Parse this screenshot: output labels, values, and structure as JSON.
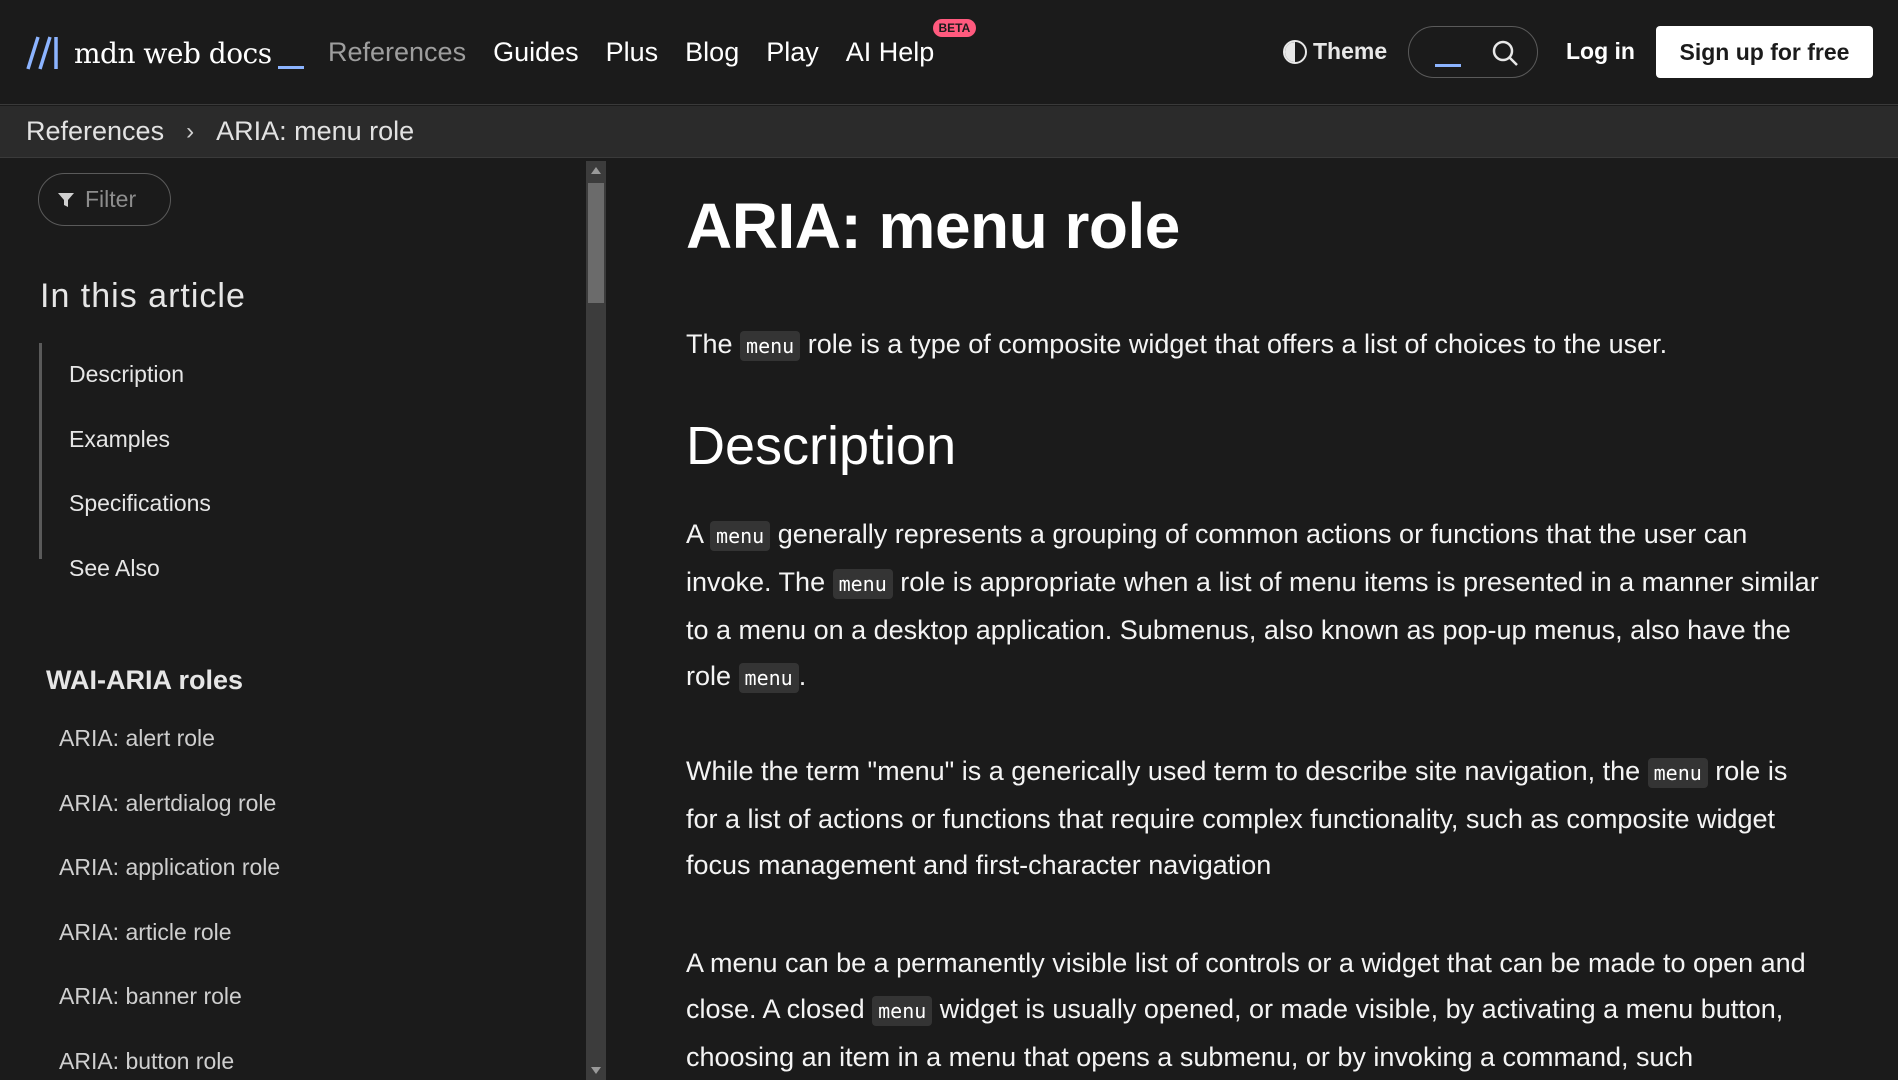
{
  "header": {
    "logo_text": "mdn web docs",
    "nav": [
      {
        "label": "References"
      },
      {
        "label": "Guides"
      },
      {
        "label": "Plus"
      },
      {
        "label": "Blog"
      },
      {
        "label": "Play"
      },
      {
        "label": "AI Help"
      }
    ],
    "beta_badge": "BETA",
    "theme_label": "Theme",
    "login_label": "Log in",
    "signup_label": "Sign up for free"
  },
  "breadcrumb": {
    "items": [
      "References",
      "ARIA: menu role"
    ],
    "separator": "›"
  },
  "sidebar": {
    "filter_placeholder": "Filter",
    "toc_title": "In this article",
    "toc_items": [
      "Description",
      "Examples",
      "Specifications",
      "See Also"
    ],
    "section_title": "WAI-ARIA roles",
    "roles": [
      "ARIA: alert role",
      "ARIA: alertdialog role",
      "ARIA: application role",
      "ARIA: article role",
      "ARIA: banner role",
      "ARIA: button role"
    ]
  },
  "main": {
    "title": "ARIA: menu role",
    "intro": {
      "a": "The ",
      "code": "menu",
      "b": " role is a type of composite widget that offers a list of choices to the user."
    },
    "description_heading": "Description",
    "p1": {
      "a": "A ",
      "code1": "menu",
      "b": " generally represents a grouping of common actions or functions that the user can invoke. The ",
      "code2": "menu",
      "c": " role is appropriate when a list of menu items is presented in a manner similar to a menu on a desktop application. Submenus, also known as pop-up menus, also have the role ",
      "code3": "menu",
      "d": "."
    },
    "p2": {
      "a": "While the term \"menu\" is a generically used term to describe site navigation, the ",
      "code": "menu",
      "b": " role is for a list of actions or functions that require complex functionality, such as composite widget focus management and first-character navigation"
    },
    "p3": {
      "a": "A menu can be a permanently visible list of controls or a widget that can be made to open and close. A closed ",
      "code": "menu",
      "b": " widget is usually opened, or made visible, by activating a menu button, choosing an item in a menu that opens a submenu, or by invoking a command, such"
    }
  },
  "colors": {
    "background": "#1b1b1b",
    "breadcrumb_bg": "#2b2b2b",
    "accent": "#8cb4ff",
    "beta": "#ff5a7e"
  }
}
